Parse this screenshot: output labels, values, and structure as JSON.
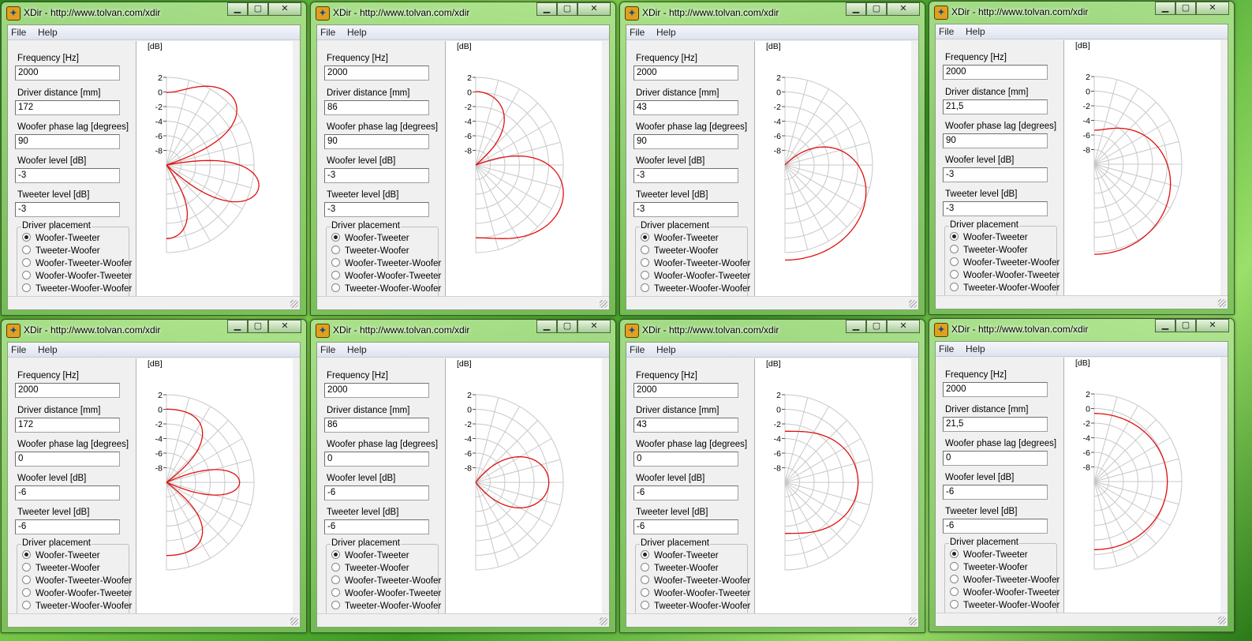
{
  "window_title": "XDir - http://www.tolvan.com/xdir",
  "menu": {
    "file": "File",
    "help": "Help"
  },
  "labels": {
    "frequency": "Frequency [Hz]",
    "distance": "Driver distance [mm]",
    "phase": "Woofer phase lag [degrees]",
    "woofer_level": "Woofer level [dB]",
    "tweeter_level": "Tweeter level [dB]",
    "placement": "Driver placement"
  },
  "placement_options": [
    "Woofer-Tweeter",
    "Tweeter-Woofer",
    "Woofer-Tweeter-Woofer",
    "Woofer-Woofer-Tweeter",
    "Tweeter-Woofer-Woofer"
  ],
  "axis": {
    "unit": "[dB]",
    "ticks": [
      "2",
      "0",
      "-2",
      "-4",
      "-6",
      "-8"
    ],
    "min_db": -10,
    "max_db": 2
  },
  "colors": {
    "curve": "#e01010",
    "grid": "#c8c8c8"
  },
  "windows": [
    {
      "frequency": "2000",
      "distance": "172",
      "phase": "90",
      "woofer_level": "-3",
      "tweeter_level": "-3",
      "placement_index": 0
    },
    {
      "frequency": "2000",
      "distance": "86",
      "phase": "90",
      "woofer_level": "-3",
      "tweeter_level": "-3",
      "placement_index": 0
    },
    {
      "frequency": "2000",
      "distance": "43",
      "phase": "90",
      "woofer_level": "-3",
      "tweeter_level": "-3",
      "placement_index": 0
    },
    {
      "frequency": "2000",
      "distance": "21,5",
      "phase": "90",
      "woofer_level": "-3",
      "tweeter_level": "-3",
      "placement_index": 0
    },
    {
      "frequency": "2000",
      "distance": "172",
      "phase": "0",
      "woofer_level": "-6",
      "tweeter_level": "-6",
      "placement_index": 0
    },
    {
      "frequency": "2000",
      "distance": "86",
      "phase": "0",
      "woofer_level": "-6",
      "tweeter_level": "-6",
      "placement_index": 0
    },
    {
      "frequency": "2000",
      "distance": "43",
      "phase": "0",
      "woofer_level": "-6",
      "tweeter_level": "-6",
      "placement_index": 0
    },
    {
      "frequency": "2000",
      "distance": "21,5",
      "phase": "0",
      "woofer_level": "-6",
      "tweeter_level": "-6",
      "placement_index": 0
    }
  ]
}
